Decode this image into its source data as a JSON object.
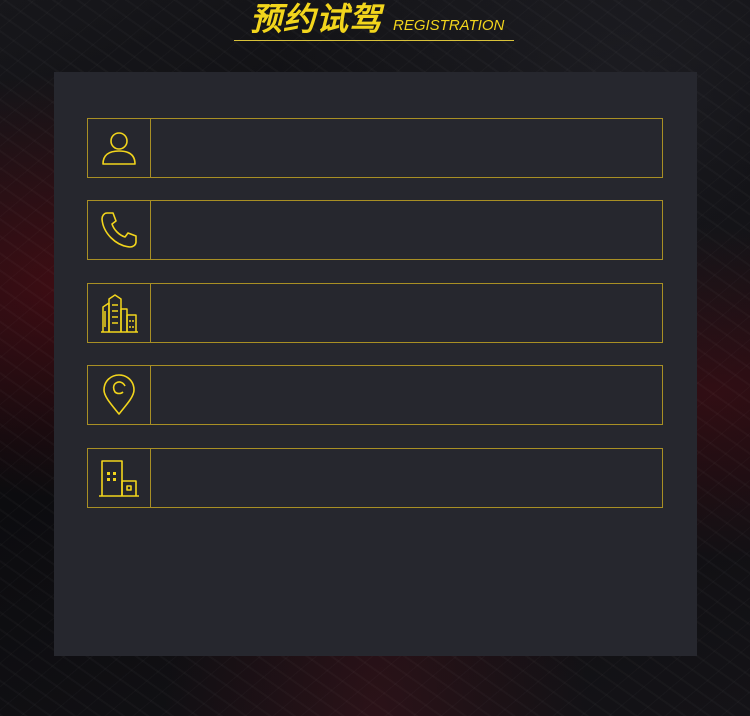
{
  "header": {
    "title_cn": "预约试驾",
    "title_en": "REGISTRATION"
  },
  "colors": {
    "accent": "#f2d51c",
    "border": "#a88f24",
    "panel": "#26272e"
  },
  "form": {
    "fields": [
      {
        "icon": "user-icon",
        "value": "",
        "placeholder": ""
      },
      {
        "icon": "phone-icon",
        "value": "",
        "placeholder": ""
      },
      {
        "icon": "city-icon",
        "value": "",
        "placeholder": ""
      },
      {
        "icon": "location-pin-icon",
        "value": "",
        "placeholder": ""
      },
      {
        "icon": "building-icon",
        "value": "",
        "placeholder": ""
      }
    ]
  }
}
